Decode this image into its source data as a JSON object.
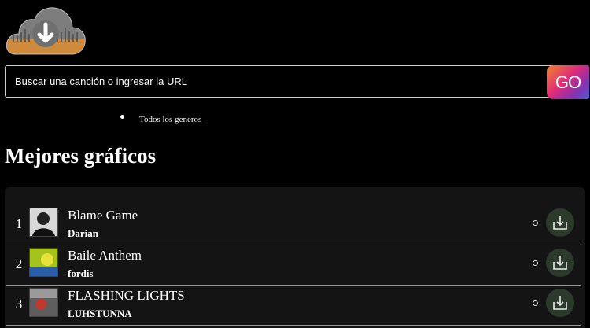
{
  "search": {
    "placeholder": "Buscar una canción o ingresar la URL",
    "go_label": "GO"
  },
  "genres": {
    "link_label": "Todos los generos"
  },
  "charts": {
    "heading": "Mejores gráficos",
    "tracks": [
      {
        "rank": "1",
        "title": "Blame Game",
        "artist": "Darian",
        "thumb_color": "#8a8a8a"
      },
      {
        "rank": "2",
        "title": "Baile Anthem",
        "artist": "fordis",
        "thumb_color": "#9fb81a"
      },
      {
        "rank": "3",
        "title": "FLASHING LIGHTS",
        "artist": "LUHSTUNNA",
        "thumb_color": "#6b6b6b"
      }
    ]
  },
  "colors": {
    "download_accent": "#2b3a2b",
    "logo_orange": "#d08a3c"
  }
}
